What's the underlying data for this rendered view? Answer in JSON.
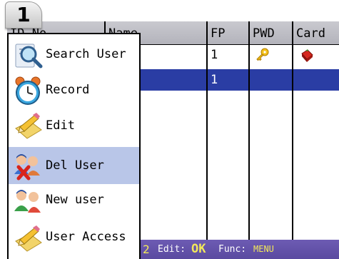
{
  "step_badge": "1",
  "table": {
    "headers": [
      "ID No.",
      "Name",
      "FP",
      "PWD",
      "Card"
    ],
    "rows": [
      {
        "fp": "1",
        "pwd_icon": "key-icon",
        "card_icon": "card-icon",
        "selected": false
      },
      {
        "fp": "1",
        "selected": true
      }
    ]
  },
  "menu": {
    "items": [
      {
        "label": "Search User",
        "icon": "search-user-icon"
      },
      {
        "label": "Record",
        "icon": "alarm-clock-icon"
      },
      {
        "label": "Edit",
        "icon": "edit-pencil-icon"
      },
      {
        "label": "Del User",
        "icon": "delete-user-icon",
        "highlighted": true
      },
      {
        "label": "New user",
        "icon": "new-user-icon"
      },
      {
        "label": "User Access",
        "icon": "user-access-icon"
      }
    ]
  },
  "status_bar": {
    "partial_digit": "2",
    "edit_label": "Edit:",
    "edit_key": "OK",
    "func_label": "Func:",
    "func_key": "MENU"
  },
  "colors": {
    "selected_row": "#2a3da4",
    "menu_highlight": "#b9c6e8",
    "status_bar": "#5a4aa0",
    "status_key": "#f2e85a"
  }
}
